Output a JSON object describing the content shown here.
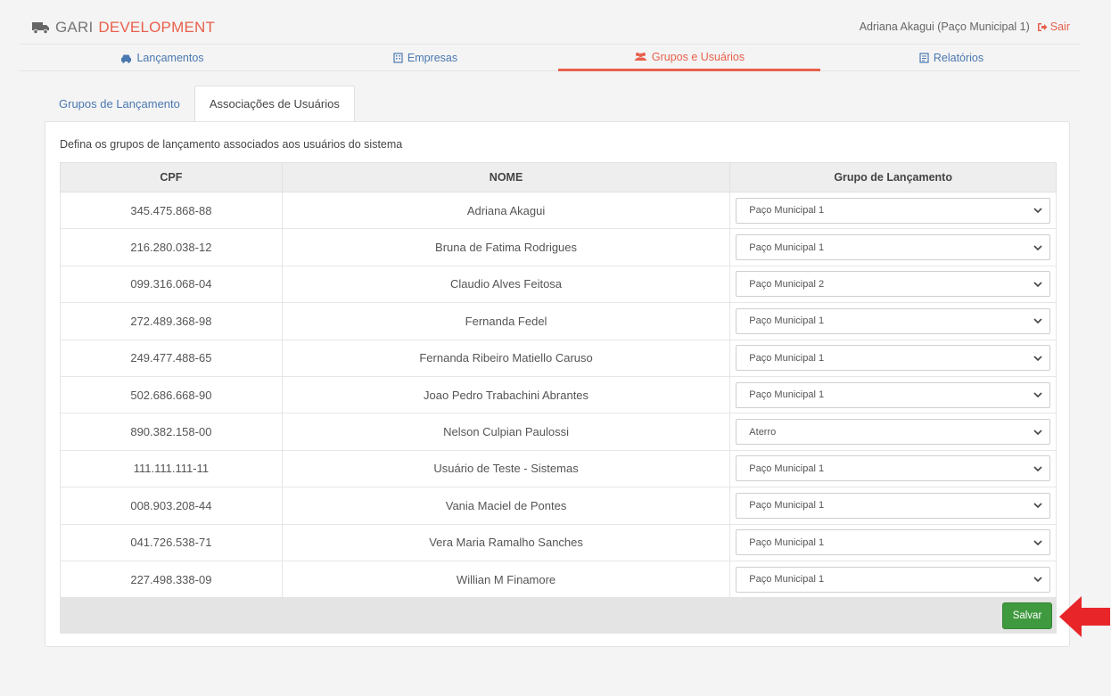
{
  "header": {
    "brand_part1": "GARI",
    "brand_part2": "DEVELOPMENT",
    "user": "Adriana Akagui (Paço Municipal 1)",
    "logout_label": "Sair"
  },
  "nav": {
    "items": [
      {
        "label": "Lançamentos",
        "icon": "car-icon"
      },
      {
        "label": "Empresas",
        "icon": "building-icon"
      },
      {
        "label": "Grupos e Usuários",
        "icon": "users-icon"
      },
      {
        "label": "Relatórios",
        "icon": "report-icon"
      }
    ],
    "active": "Grupos e Usuários"
  },
  "tabs": [
    {
      "label": "Grupos de Lançamento"
    },
    {
      "label": "Associações de Usuários"
    }
  ],
  "main": {
    "description": "Defina os grupos de lançamento associados aos usuários do sistema",
    "columns": [
      "CPF",
      "NOME",
      "Grupo de Lançamento"
    ],
    "rows": [
      {
        "cpf": "345.475.868-88",
        "nome": "Adriana Akagui",
        "grupo": "Paço Municipal 1"
      },
      {
        "cpf": "216.280.038-12",
        "nome": "Bruna de Fatima Rodrigues",
        "grupo": "Paço Municipal 1"
      },
      {
        "cpf": "099.316.068-04",
        "nome": "Claudio Alves Feitosa",
        "grupo": "Paço Municipal 2"
      },
      {
        "cpf": "272.489.368-98",
        "nome": "Fernanda Fedel",
        "grupo": "Paço Municipal 1"
      },
      {
        "cpf": "249.477.488-65",
        "nome": "Fernanda Ribeiro Matiello Caruso",
        "grupo": "Paço Municipal 1"
      },
      {
        "cpf": "502.686.668-90",
        "nome": "Joao Pedro Trabachini Abrantes",
        "grupo": "Paço Municipal 1"
      },
      {
        "cpf": "890.382.158-00",
        "nome": "Nelson Culpian Paulossi",
        "grupo": "Aterro"
      },
      {
        "cpf": "111.111.111-11",
        "nome": "Usuário de Teste - Sistemas",
        "grupo": "Paço Municipal 1"
      },
      {
        "cpf": "008.903.208-44",
        "nome": "Vania Maciel de Pontes",
        "grupo": "Paço Municipal 1"
      },
      {
        "cpf": "041.726.538-71",
        "nome": "Vera Maria Ramalho Sanches",
        "grupo": "Paço Municipal 1"
      },
      {
        "cpf": "227.498.338-09",
        "nome": "Willian M Finamore",
        "grupo": "Paço Municipal 1"
      }
    ],
    "save_label": "Salvar"
  },
  "colors": {
    "accent": "#e8604c",
    "link": "#4a78b0",
    "save": "#3f9a3f",
    "arrow": "#e8262a"
  }
}
